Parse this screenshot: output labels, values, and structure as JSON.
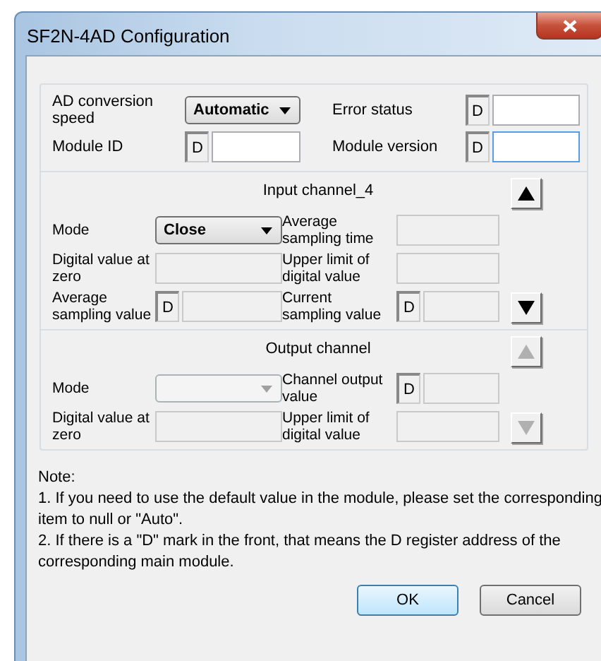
{
  "window": {
    "title": "SF2N-4AD Configuration"
  },
  "general": {
    "fields": [
      {
        "label": "AD conversion speed",
        "kind": "combo",
        "value": "Automatic",
        "disabled": false
      },
      {
        "label": "Error status",
        "kind": "dfield",
        "prefix": "D",
        "disabled": false,
        "focused": false
      },
      {
        "label": "Module ID",
        "kind": "dfield",
        "prefix": "D",
        "disabled": false,
        "focused": false
      },
      {
        "label": "Module version",
        "kind": "dfield",
        "prefix": "D",
        "disabled": false,
        "focused": true
      }
    ]
  },
  "input_channel": {
    "title": "Input channel_4",
    "scroll_up": {
      "disabled": false
    },
    "scroll_down": {
      "disabled": false
    },
    "fields": [
      {
        "label": "Mode",
        "kind": "combo",
        "value": "Close",
        "disabled": false
      },
      {
        "label": "Average sampling time",
        "kind": "text",
        "disabled": true
      },
      {
        "label": "Digital value at zero",
        "kind": "text",
        "disabled": true
      },
      {
        "label": "Upper limit of digital value",
        "kind": "text",
        "disabled": true
      },
      {
        "label": "Average sampling value",
        "kind": "dfield",
        "prefix": "D",
        "disabled": true,
        "focused": false
      },
      {
        "label": "Current sampling value",
        "kind": "dfield",
        "prefix": "D",
        "disabled": true,
        "focused": false
      }
    ]
  },
  "output_channel": {
    "title": "Output channel",
    "scroll_up": {
      "disabled": true
    },
    "scroll_down": {
      "disabled": true
    },
    "fields": [
      {
        "label": "Mode",
        "kind": "combo",
        "disabled": true
      },
      {
        "label": "Channel output value",
        "kind": "dfield",
        "prefix": "D",
        "disabled": true,
        "focused": false
      },
      {
        "label": "Digital value at zero",
        "kind": "text",
        "disabled": true
      },
      {
        "label": "Upper limit of digital value",
        "kind": "text",
        "disabled": true
      }
    ]
  },
  "note": {
    "title": "Note:",
    "items": [
      "1. If you need to use the default value in the module, please set the corresponding item to null or \"Auto\".",
      "2. If there is a \"D\" mark in the front, that means the D register address of the corresponding main module."
    ]
  },
  "buttons": [
    {
      "label": "OK",
      "default": true
    },
    {
      "label": "Cancel",
      "default": false
    }
  ]
}
